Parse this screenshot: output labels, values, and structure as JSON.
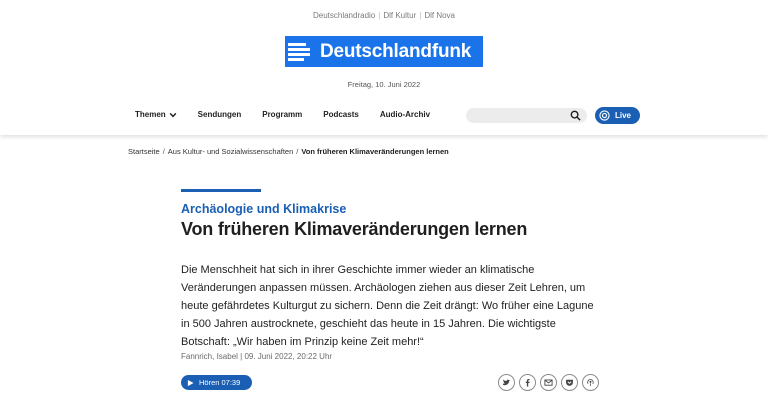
{
  "network": {
    "items": [
      "Deutschlandradio",
      "Dlf Kultur",
      "Dlf Nova"
    ],
    "separator": "|"
  },
  "logo": {
    "text": "Deutschlandfunk",
    "color": "#1a73e8"
  },
  "header": {
    "date": "Freitag, 10. Juni 2022"
  },
  "nav": {
    "themen": "Themen",
    "sendungen": "Sendungen",
    "programm": "Programm",
    "podcasts": "Podcasts",
    "audio_archiv": "Audio-Archiv"
  },
  "search": {
    "placeholder": ""
  },
  "live": {
    "label": "Live"
  },
  "breadcrumb": {
    "home": "Startseite",
    "section": "Aus Kultur- und Sozialwissenschaften",
    "current": "Von früheren Klimaveränderungen lernen",
    "separator": "/"
  },
  "article": {
    "kicker": "Archäologie und Klimakrise",
    "headline": "Von früheren Klimaveränderungen lernen",
    "teaser": "Die Menschheit hat sich in ihrer Geschichte immer wieder an klimatische Veränderungen anpassen müssen. Archäologen ziehen aus dieser Zeit Lehren, um heute gefährdetes Kulturgut zu sichern. Denn die Zeit drängt: Wo früher eine Lagune in 500 Jahren austrocknete, geschieht das heute in 15 Jahren. Die wichtigste Botschaft: „Wir haben im Prinzip keine Zeit mehr!“",
    "meta": "Fannrich, Isabel | 09. Juni 2022, 20:22 Uhr",
    "listen_label": "Hören 07:39"
  },
  "share_icons": [
    "twitter-icon",
    "facebook-icon",
    "email-icon",
    "pocket-icon",
    "podcast-icon"
  ],
  "colors": {
    "accent": "#1a5fb4",
    "brand": "#1a73e8"
  }
}
